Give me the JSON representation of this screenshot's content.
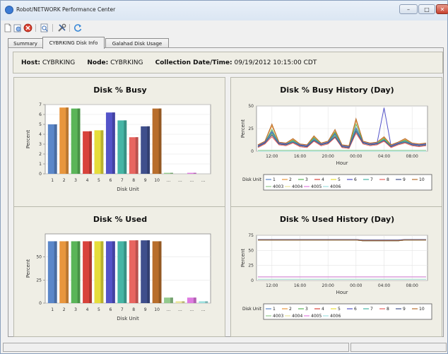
{
  "window": {
    "title": "Robot/NETWORK Performance Center",
    "controls": {
      "minimize": "–",
      "maximize": "□",
      "close": "✕"
    }
  },
  "toolbar": {
    "icons": [
      "new-document-icon",
      "open-report-icon",
      "stop-icon",
      "print-preview-icon",
      "tools-icon",
      "refresh-icon"
    ]
  },
  "tabs": [
    {
      "label": "Summary",
      "active": false
    },
    {
      "label": "CYBRKING Disk Info",
      "active": true
    },
    {
      "label": "Galahad Disk Usage",
      "active": false
    }
  ],
  "info": {
    "host_label": "Host:",
    "host_value": "CYBRKING",
    "node_label": "Node:",
    "node_value": "CYBRKING",
    "date_label": "Collection Date/Time:",
    "date_value": "09/19/2012 10:15:00 CDT"
  },
  "colors": {
    "series": [
      "#5b87c9",
      "#e8963d",
      "#5ab558",
      "#d8433b",
      "#e6dd3b",
      "#5454c9",
      "#46b5a5",
      "#e86560",
      "#3f4f8c",
      "#b86e2c",
      "#93ca8d",
      "#e9e49a",
      "#de7be0",
      "#9ee0de"
    ],
    "panel_bg": "#efeee5",
    "plot_bg": "#ffffff"
  },
  "chart_data": [
    {
      "type": "bar",
      "title": "Disk % Busy",
      "xlabel": "Disk Unit",
      "ylabel": "Percent",
      "categories": [
        "1",
        "2",
        "3",
        "4",
        "5",
        "6",
        "7",
        "8",
        "9",
        "10",
        "...",
        "...",
        "...",
        "..."
      ],
      "values": [
        5.0,
        6.7,
        6.6,
        4.3,
        4.4,
        6.2,
        5.4,
        3.7,
        4.8,
        6.6,
        0.1,
        0.0,
        0.1,
        0.0
      ],
      "ylim": [
        0,
        7
      ],
      "yticks": [
        0,
        1,
        2,
        3,
        4,
        5,
        6,
        7
      ],
      "grid": true
    },
    {
      "type": "line",
      "title": "Disk % Busy History (Day)",
      "xlabel": "Hour",
      "ylabel": "Percent",
      "x": [
        "10:15",
        "11:00",
        "12:00",
        "13:00",
        "14:00",
        "15:00",
        "16:00",
        "17:00",
        "18:00",
        "19:00",
        "20:00",
        "21:00",
        "22:00",
        "23:00",
        "00:00",
        "01:00",
        "02:00",
        "03:00",
        "04:00",
        "05:00",
        "06:00",
        "07:00",
        "08:00",
        "09:00",
        "10:00"
      ],
      "xticks": [
        "12:00",
        "16:00",
        "20:00",
        "00:00",
        "04:00",
        "08:00"
      ],
      "ylim": [
        0,
        50
      ],
      "yticks": [
        0,
        25,
        50
      ],
      "legend_title": "Disk Unit",
      "legend": [
        "1",
        "2",
        "3",
        "4",
        "5",
        "6",
        "7",
        "8",
        "9",
        "10",
        "4003",
        "4004",
        "4005",
        "4006"
      ],
      "series": [
        {
          "name": "1",
          "values": [
            6,
            10,
            22,
            9,
            8,
            12,
            7,
            6,
            14,
            8,
            10,
            20,
            6,
            5,
            26,
            10,
            8,
            9,
            14,
            6,
            9,
            12,
            8,
            7,
            8
          ]
        },
        {
          "name": "2",
          "values": [
            7,
            11,
            28,
            10,
            9,
            13,
            8,
            7,
            16,
            9,
            11,
            22,
            7,
            6,
            34,
            11,
            9,
            10,
            15,
            7,
            10,
            13,
            9,
            8,
            9
          ]
        },
        {
          "name": "3",
          "values": [
            6,
            10,
            24,
            9,
            8,
            12,
            7,
            6,
            15,
            8,
            10,
            21,
            6,
            5,
            30,
            10,
            8,
            9,
            14,
            6,
            9,
            12,
            8,
            7,
            8
          ]
        },
        {
          "name": "4",
          "values": [
            5,
            9,
            18,
            8,
            7,
            10,
            6,
            5,
            12,
            7,
            9,
            17,
            5,
            4,
            22,
            9,
            7,
            8,
            12,
            5,
            8,
            10,
            7,
            6,
            7
          ]
        },
        {
          "name": "5",
          "values": [
            5,
            9,
            19,
            8,
            7,
            10,
            6,
            5,
            12,
            7,
            9,
            17,
            5,
            4,
            23,
            9,
            7,
            8,
            12,
            5,
            8,
            10,
            7,
            6,
            7
          ]
        },
        {
          "name": "6",
          "values": [
            6,
            10,
            21,
            9,
            8,
            11,
            7,
            6,
            13,
            8,
            10,
            19,
            6,
            5,
            25,
            10,
            8,
            9,
            48,
            6,
            9,
            11,
            8,
            7,
            8
          ]
        },
        {
          "name": "7",
          "values": [
            5,
            9,
            20,
            8,
            7,
            11,
            6,
            5,
            13,
            7,
            9,
            18,
            5,
            4,
            24,
            9,
            7,
            8,
            13,
            5,
            8,
            11,
            7,
            6,
            7
          ]
        },
        {
          "name": "8",
          "values": [
            4,
            8,
            16,
            7,
            6,
            9,
            5,
            4,
            11,
            6,
            8,
            15,
            4,
            3,
            20,
            8,
            6,
            7,
            11,
            4,
            7,
            9,
            6,
            5,
            6
          ]
        },
        {
          "name": "9",
          "values": [
            5,
            9,
            18,
            8,
            7,
            10,
            6,
            5,
            12,
            7,
            9,
            16,
            5,
            4,
            22,
            9,
            7,
            8,
            12,
            5,
            8,
            10,
            7,
            6,
            7
          ]
        },
        {
          "name": "10",
          "values": [
            7,
            11,
            30,
            10,
            9,
            14,
            8,
            7,
            17,
            9,
            11,
            24,
            7,
            6,
            36,
            11,
            9,
            10,
            16,
            7,
            10,
            14,
            9,
            8,
            9
          ]
        },
        {
          "name": "4003",
          "values": [
            1,
            1,
            1,
            1,
            1,
            1,
            1,
            1,
            1,
            1,
            1,
            1,
            1,
            1,
            1,
            1,
            1,
            1,
            1,
            1,
            1,
            1,
            1,
            1,
            1
          ]
        },
        {
          "name": "4004",
          "values": [
            0,
            0,
            0,
            0,
            0,
            0,
            0,
            0,
            0,
            0,
            0,
            0,
            0,
            0,
            0,
            0,
            0,
            0,
            0,
            0,
            0,
            0,
            0,
            0,
            0
          ]
        },
        {
          "name": "4005",
          "values": [
            0,
            0,
            0,
            0,
            0,
            0,
            0,
            0,
            0,
            0,
            0,
            0,
            0,
            0,
            0,
            0,
            0,
            0,
            0,
            0,
            0,
            0,
            0,
            0,
            0
          ]
        },
        {
          "name": "4006",
          "values": [
            0,
            0,
            0,
            0,
            0,
            0,
            0,
            0,
            0,
            0,
            0,
            0,
            0,
            0,
            0,
            0,
            0,
            0,
            0,
            0,
            0,
            0,
            0,
            0,
            0
          ]
        }
      ],
      "grid": true
    },
    {
      "type": "bar",
      "title": "Disk % Used",
      "xlabel": "Disk Unit",
      "ylabel": "Percent",
      "categories": [
        "1",
        "2",
        "3",
        "4",
        "5",
        "6",
        "7",
        "8",
        "9",
        "10",
        "...",
        "...",
        "...",
        "..."
      ],
      "values": [
        67,
        67,
        67,
        67,
        67,
        67,
        67,
        68,
        68,
        67,
        6,
        2,
        6,
        2
      ],
      "ylim": [
        0,
        75
      ],
      "yticks": [
        0,
        25,
        50
      ],
      "grid": true
    },
    {
      "type": "line",
      "title": "Disk % Used History (Day)",
      "xlabel": "Hour",
      "ylabel": "Percent",
      "x": [
        "10:15",
        "11:00",
        "12:00",
        "13:00",
        "14:00",
        "15:00",
        "16:00",
        "17:00",
        "18:00",
        "19:00",
        "20:00",
        "21:00",
        "22:00",
        "23:00",
        "00:00",
        "01:00",
        "02:00",
        "03:00",
        "04:00",
        "05:00",
        "06:00",
        "07:00",
        "08:00",
        "09:00",
        "10:00"
      ],
      "xticks": [
        "12:00",
        "16:00",
        "20:00",
        "00:00",
        "04:00",
        "08:00"
      ],
      "ylim": [
        0,
        75
      ],
      "yticks": [
        0,
        25,
        50,
        75
      ],
      "legend_title": "Disk Unit",
      "legend": [
        "1",
        "2",
        "3",
        "4",
        "5",
        "6",
        "7",
        "8",
        "9",
        "10",
        "4003",
        "4004",
        "4005",
        "4006"
      ],
      "series": [
        {
          "name": "1",
          "values": [
            67,
            67,
            67,
            67,
            67,
            67,
            67,
            67,
            67,
            67,
            67,
            67,
            67,
            67,
            67,
            66,
            66,
            66,
            66,
            66,
            66,
            67,
            67,
            67,
            67
          ]
        },
        {
          "name": "2",
          "values": [
            67,
            67,
            67,
            67,
            67,
            67,
            67,
            67,
            67,
            67,
            67,
            67,
            67,
            67,
            67,
            66,
            66,
            66,
            66,
            66,
            66,
            67,
            67,
            67,
            67
          ]
        },
        {
          "name": "3",
          "values": [
            67,
            67,
            67,
            67,
            67,
            67,
            67,
            67,
            67,
            67,
            67,
            67,
            67,
            67,
            67,
            66,
            66,
            66,
            66,
            66,
            66,
            67,
            67,
            67,
            67
          ]
        },
        {
          "name": "4",
          "values": [
            67,
            67,
            67,
            67,
            67,
            67,
            67,
            67,
            67,
            67,
            67,
            67,
            67,
            67,
            67,
            66,
            66,
            66,
            66,
            66,
            66,
            67,
            67,
            67,
            67
          ]
        },
        {
          "name": "5",
          "values": [
            67,
            67,
            67,
            67,
            67,
            67,
            67,
            67,
            67,
            67,
            67,
            67,
            67,
            67,
            67,
            66,
            66,
            66,
            66,
            66,
            66,
            67,
            67,
            67,
            67
          ]
        },
        {
          "name": "6",
          "values": [
            67,
            67,
            67,
            67,
            67,
            67,
            67,
            67,
            67,
            67,
            67,
            67,
            67,
            67,
            67,
            66,
            66,
            66,
            66,
            66,
            66,
            67,
            67,
            67,
            67
          ]
        },
        {
          "name": "7",
          "values": [
            67,
            67,
            67,
            67,
            67,
            67,
            67,
            67,
            67,
            67,
            67,
            67,
            67,
            67,
            67,
            66,
            66,
            66,
            66,
            66,
            66,
            67,
            67,
            67,
            67
          ]
        },
        {
          "name": "8",
          "values": [
            68,
            68,
            68,
            68,
            68,
            68,
            68,
            68,
            68,
            68,
            68,
            68,
            68,
            68,
            68,
            67,
            67,
            67,
            67,
            67,
            67,
            68,
            68,
            68,
            68
          ]
        },
        {
          "name": "9",
          "values": [
            68,
            68,
            68,
            68,
            68,
            68,
            68,
            68,
            68,
            68,
            68,
            68,
            68,
            68,
            68,
            67,
            67,
            67,
            67,
            67,
            67,
            68,
            68,
            68,
            68
          ]
        },
        {
          "name": "10",
          "values": [
            67,
            67,
            67,
            67,
            67,
            67,
            67,
            67,
            67,
            67,
            67,
            67,
            67,
            67,
            67,
            66,
            66,
            66,
            66,
            66,
            66,
            67,
            67,
            67,
            67
          ]
        },
        {
          "name": "4003",
          "values": [
            6,
            6,
            6,
            6,
            6,
            6,
            6,
            6,
            6,
            6,
            6,
            6,
            6,
            6,
            6,
            6,
            6,
            6,
            6,
            6,
            6,
            6,
            6,
            6,
            6
          ]
        },
        {
          "name": "4004",
          "values": [
            2,
            2,
            2,
            2,
            2,
            2,
            2,
            2,
            2,
            2,
            2,
            2,
            2,
            2,
            2,
            2,
            2,
            2,
            2,
            2,
            2,
            2,
            2,
            2,
            2
          ]
        },
        {
          "name": "4005",
          "values": [
            6,
            6,
            6,
            6,
            6,
            6,
            6,
            6,
            6,
            6,
            6,
            6,
            6,
            6,
            6,
            6,
            6,
            6,
            6,
            6,
            6,
            6,
            6,
            6,
            6
          ]
        },
        {
          "name": "4006",
          "values": [
            2,
            2,
            2,
            2,
            2,
            2,
            2,
            2,
            2,
            2,
            2,
            2,
            2,
            2,
            2,
            2,
            2,
            2,
            2,
            2,
            2,
            2,
            2,
            2,
            2
          ]
        }
      ],
      "grid": true
    }
  ]
}
